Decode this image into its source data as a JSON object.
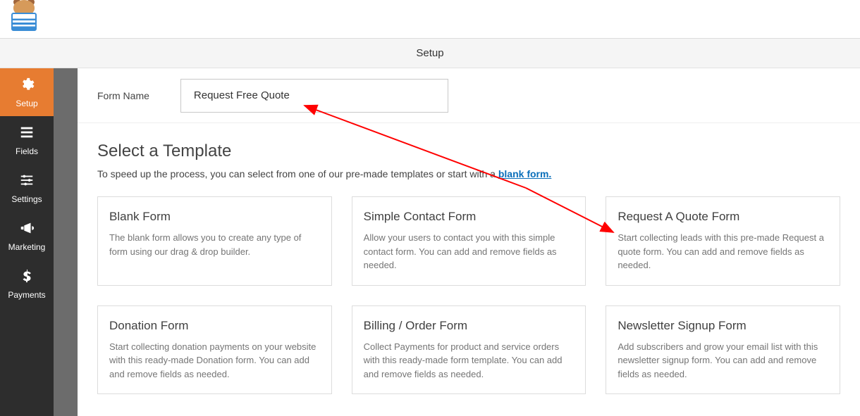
{
  "tab_title": "Setup",
  "sidebar": {
    "items": [
      {
        "label": "Setup"
      },
      {
        "label": "Fields"
      },
      {
        "label": "Settings"
      },
      {
        "label": "Marketing"
      },
      {
        "label": "Payments"
      }
    ]
  },
  "form_name": {
    "label": "Form Name",
    "value": "Request Free Quote"
  },
  "templates": {
    "title": "Select a Template",
    "subtitle_pre": "To speed up the process, you can select from one of our pre-made templates or start with a ",
    "subtitle_link": "blank form.",
    "cards": [
      {
        "title": "Blank Form",
        "desc": "The blank form allows you to create any type of form using our drag & drop builder."
      },
      {
        "title": "Simple Contact Form",
        "desc": "Allow your users to contact you with this simple contact form. You can add and remove fields as needed."
      },
      {
        "title": "Request A Quote Form",
        "desc": "Start collecting leads with this pre-made Request a quote form. You can add and remove fields as needed."
      },
      {
        "title": "Donation Form",
        "desc": "Start collecting donation payments on your website with this ready-made Donation form. You can add and remove fields as needed."
      },
      {
        "title": "Billing / Order Form",
        "desc": "Collect Payments for product and service orders with this ready-made form template. You can add and remove fields as needed."
      },
      {
        "title": "Newsletter Signup Form",
        "desc": "Add subscribers and grow your email list with this newsletter signup form. You can add and remove fields as needed."
      }
    ]
  }
}
